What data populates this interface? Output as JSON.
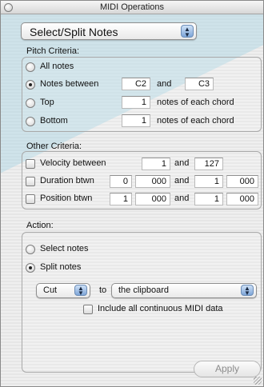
{
  "window": {
    "title": "MIDI Operations"
  },
  "operation": {
    "selected": "Select/Split Notes"
  },
  "pitch": {
    "label": "Pitch Criteria:",
    "all_notes": "All notes",
    "notes_between": "Notes between",
    "from": "C2",
    "and": "and",
    "to": "C3",
    "top": "Top",
    "top_value": "1",
    "top_suffix": "notes of each chord",
    "bottom": "Bottom",
    "bottom_value": "1",
    "bottom_suffix": "notes of each chord",
    "selected": "Notes between"
  },
  "other": {
    "label": "Other Criteria:",
    "velocity": {
      "label": "Velocity between",
      "from": "1",
      "and": "and",
      "to": "127"
    },
    "duration": {
      "label": "Duration btwn",
      "from_a": "0",
      "from_b": "000",
      "and": "and",
      "to_a": "1",
      "to_b": "000"
    },
    "position": {
      "label": "Position btwn",
      "from_a": "1",
      "from_b": "000",
      "and": "and",
      "to_a": "1",
      "to_b": "000"
    }
  },
  "action": {
    "label": "Action:",
    "select_notes": "Select notes",
    "split_notes": "Split notes",
    "selected": "Split notes",
    "mode": "Cut",
    "to": "to",
    "destination": "the clipboard",
    "include_midi": "Include all continuous MIDI data"
  },
  "buttons": {
    "apply": "Apply"
  }
}
